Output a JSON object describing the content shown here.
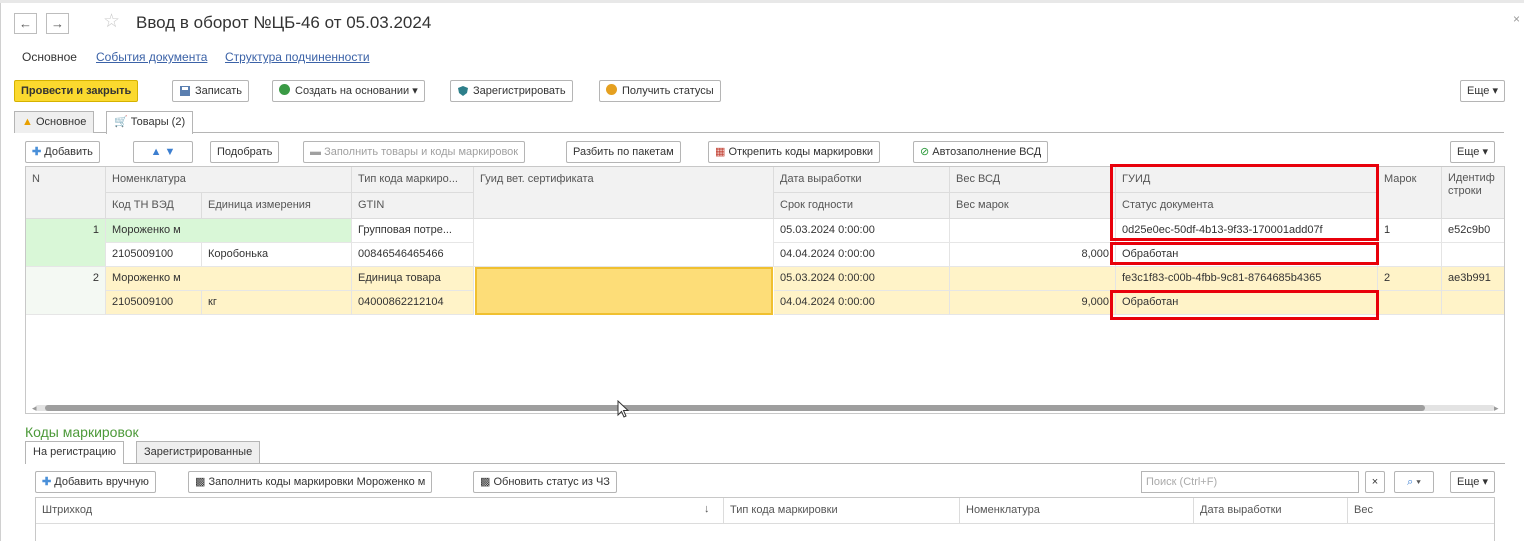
{
  "window": {
    "title": "Ввод в оборот №ЦБ-46 от 05.03.2024",
    "back_glyph": "←",
    "forward_glyph": "→",
    "star_glyph": "☆",
    "close_glyph": "×"
  },
  "top_nav": {
    "main": "Основное",
    "events": "События документа",
    "structure": "Структура подчиненности"
  },
  "toolbar": {
    "post_close": "Провести и закрыть",
    "save": "Записать",
    "create_based": "Создать на основании",
    "register": "Зарегистрировать",
    "get_status": "Получить статусы",
    "more": "Еще"
  },
  "tabs": {
    "main": "Основное",
    "goods": "Товары (2)"
  },
  "goods_toolbar": {
    "add": "Добавить",
    "pick": "Подобрать",
    "fill": "Заполнить товары и коды маркировок",
    "split": "Разбить по пакетам",
    "detach": "Открепить коды маркировки",
    "autofill": "Автозаполнение ВСД",
    "more": "Еще"
  },
  "columns": {
    "n": "N",
    "nom": "Номенклатура",
    "code_type": "Тип кода маркиро...",
    "guid_cert": "Гуид вет. сертификата",
    "prod_date": "Дата выработки",
    "weight_vsd": "Вес ВСД",
    "guid": "ГУИД",
    "marks": "Марок",
    "ident": "Идентиф строки",
    "tn_ved": "Код ТН ВЭД",
    "unit": "Единица измерения",
    "gtin": "GTIN",
    "expiry": "Срок годности",
    "weight_marks": "Вес марок",
    "doc_status": "Статус документа"
  },
  "rows": [
    {
      "n": "1",
      "nom": "Мороженко м",
      "code_type": "Групповая потре...",
      "prod_date": "05.03.2024 0:00:00",
      "weight_vsd": "",
      "guid": "0d25e0ec-50df-4b13-9f33-170001add07f",
      "marks": "1",
      "ident": "e52c9b0",
      "tn_ved": "2105009100",
      "unit": "Коробонька",
      "gtin": "00846546465466",
      "expiry": "04.04.2024 0:00:00",
      "weight_marks": "8,000",
      "doc_status": "Обработан"
    },
    {
      "n": "2",
      "nom": "Мороженко м",
      "code_type": "Единица товара",
      "prod_date": "05.03.2024 0:00:00",
      "weight_vsd": "",
      "guid": "fe3c1f83-c00b-4fbb-9c81-8764685b4365",
      "marks": "2",
      "ident": "ae3b991",
      "tn_ved": "2105009100",
      "unit": "кг",
      "gtin": "04000862212104",
      "expiry": "04.04.2024 0:00:00",
      "weight_marks": "9,000",
      "doc_status": "Обработан"
    }
  ],
  "marking": {
    "title": "Коды маркировок",
    "tab_reg": "На регистрацию",
    "tab_registered": "Зарегистрированные",
    "add_manual": "Добавить вручную",
    "fill_codes": "Заполнить коды маркировки Мороженко м",
    "update_status": "Обновить статус из ЧЗ",
    "search_placeholder": "Поиск (Ctrl+F)",
    "clear_glyph": "×",
    "more": "Еще",
    "cols": {
      "barcode": "Штрихкод",
      "sort_glyph": "↓",
      "code_type": "Тип кода маркировки",
      "nom": "Номенклатура",
      "prod_date": "Дата выработки",
      "weight": "Вес"
    }
  },
  "colors": {
    "primary_button": "#fbd92e",
    "selected_row": "#fff3c8",
    "first_row": "#d9f7d7",
    "highlight_red": "#e8000b",
    "section_green": "#4d9a3a"
  }
}
